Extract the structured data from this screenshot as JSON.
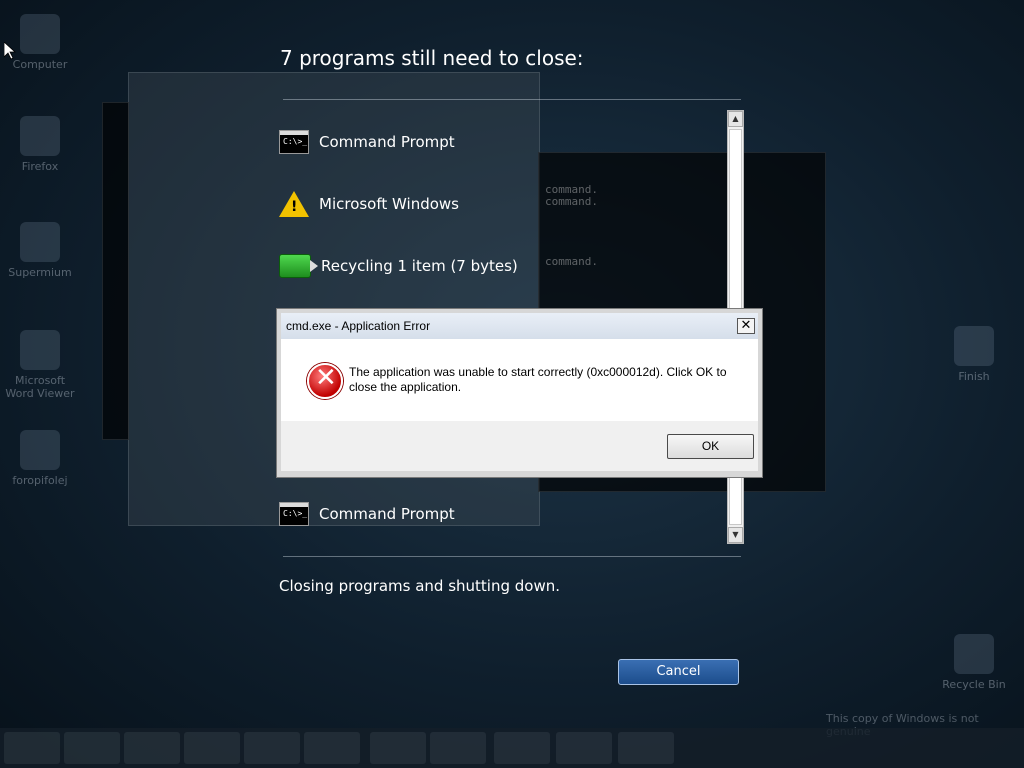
{
  "desktop": {
    "icons": [
      {
        "label": "Computer"
      },
      {
        "label": "Firefox"
      },
      {
        "label": "Supermium"
      },
      {
        "label": "Microsoft Word Viewer"
      },
      {
        "label": "foropifolej"
      },
      {
        "label": "Finish"
      },
      {
        "label": "Recycle Bin"
      }
    ],
    "watermark": "This copy of Windows is not genuine"
  },
  "shutdown": {
    "title": "7 programs still need to close:",
    "programs": [
      {
        "name": "Command Prompt",
        "icon": "cmd-icon"
      },
      {
        "name": "Microsoft Windows",
        "icon": "warning-icon"
      },
      {
        "name": "Recycling 1 item (7 bytes)",
        "icon": "recycle-progress-icon"
      },
      {
        "name": "Command Prompt",
        "icon": "cmd-icon"
      }
    ],
    "status": "Closing programs and shutting down.",
    "cancel_label": "Cancel"
  },
  "dialog": {
    "title": "cmd.exe - Application Error",
    "close_label": "✕",
    "message": "The application was unable to start correctly (0xc000012d). Click OK to close the application.",
    "ok_label": "OK",
    "icon": "error-icon"
  }
}
